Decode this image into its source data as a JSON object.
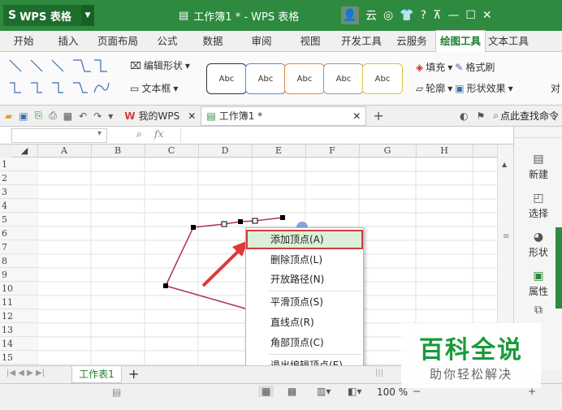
{
  "titlebar": {
    "app_name": "WPS 表格",
    "doc_title": "工作簿1 * - WPS 表格",
    "cloud_label": "云"
  },
  "tabs": [
    "开始",
    "插入",
    "页面布局",
    "公式",
    "数据",
    "审阅",
    "视图",
    "开发工具",
    "云服务",
    "绘图工具",
    "文本工具"
  ],
  "active_tab": "绘图工具",
  "ribbon": {
    "edit_shape": "编辑形状",
    "text_box": "文本框",
    "style_labels": [
      "Abc",
      "Abc",
      "Abc",
      "Abc",
      "Abc"
    ],
    "fill": "填充",
    "format_brush": "格式刷",
    "outline": "轮廓",
    "shape_effect": "形状效果",
    "align_partial": "对"
  },
  "toolbar": {
    "my_wps": "我的WPS",
    "doc_tab": "工作簿1 *",
    "search_cmd": "点此查找命令",
    "fx": "fx"
  },
  "grid": {
    "columns": [
      "A",
      "B",
      "C",
      "D",
      "E",
      "F",
      "G",
      "H"
    ],
    "rows": [
      "1",
      "2",
      "3",
      "4",
      "5",
      "6",
      "7",
      "8",
      "9",
      "10",
      "11",
      "12",
      "13",
      "14",
      "15"
    ]
  },
  "side_panel": [
    "新建",
    "选择",
    "形状",
    "属性"
  ],
  "sheetbar": {
    "sheet_name": "工作表1",
    "add": "+"
  },
  "statusbar": {
    "zoom": "100 %"
  },
  "context_menu": [
    {
      "label": "添加顶点(A)",
      "highlight": true
    },
    {
      "label": "删除顶点(L)"
    },
    {
      "label": "开放路径(N)"
    },
    {
      "label": "平滑顶点(S)"
    },
    {
      "label": "直线点(R)"
    },
    {
      "label": "角部顶点(C)"
    },
    {
      "label": "退出编辑顶点(E)"
    }
  ],
  "watermark": {
    "title": "百科全说",
    "subtitle": "助你轻松解决"
  },
  "colors": {
    "accent": "#2d8a3e",
    "shape_line": "#b0374a",
    "arrow": "#e03838"
  }
}
